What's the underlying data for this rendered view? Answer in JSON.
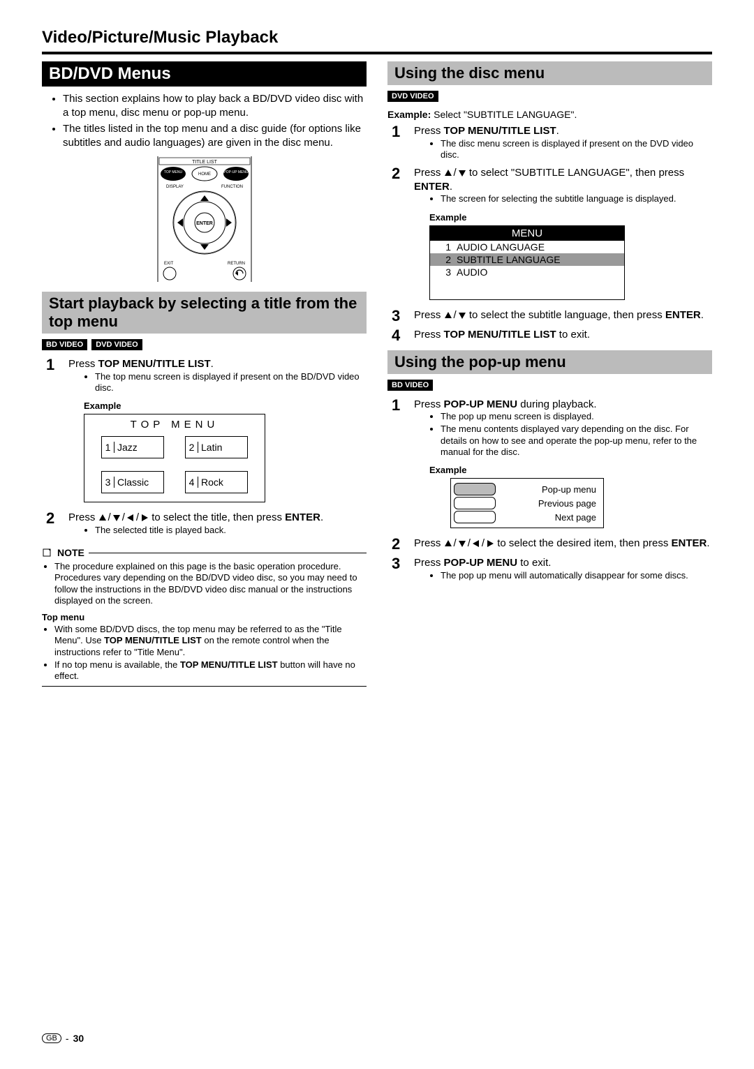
{
  "page": {
    "title": "Video/Picture/Music Playback"
  },
  "left": {
    "h_black": "BD/DVD Menus",
    "intro_bullets": [
      "This section explains how to play back a BD/DVD video disc with a top menu, disc menu or pop-up menu.",
      "The titles listed in the top menu and a disc guide (for options like subtitles and audio languages) are given in the disc menu."
    ],
    "remote": {
      "title_list": "TITLE LIST",
      "top_menu": "TOP MENU",
      "home": "HOME",
      "popup_menu": "POP-UP MENU",
      "display": "DISPLAY",
      "function": "FUNCTION",
      "enter": "ENTER",
      "exit": "EXIT",
      "return": "RETURN"
    },
    "h_gray": "Start playback by selecting a title from the top menu",
    "badges": [
      "BD VIDEO",
      "DVD VIDEO"
    ],
    "step1": {
      "text_pre": "Press ",
      "text_bold": "TOP MENU/TITLE LIST",
      "text_post": ".",
      "sub": "The top menu screen is displayed if present on the BD/DVD video disc."
    },
    "topmenu": {
      "example": "Example",
      "title": "TOP MENU",
      "cells": [
        {
          "n": "1",
          "t": "Jazz"
        },
        {
          "n": "2",
          "t": "Latin"
        },
        {
          "n": "3",
          "t": "Classic"
        },
        {
          "n": "4",
          "t": "Rock"
        }
      ]
    },
    "step2": {
      "text_pre": "Press ",
      "text_mid": " to select the title, then press ",
      "text_bold": "ENTER",
      "text_post": ".",
      "sub": "The selected title is played back."
    },
    "note": {
      "label": "NOTE",
      "bullets": [
        "The procedure explained on this page is the basic operation procedure. Procedures vary depending on the BD/DVD video disc, so you may need to follow the instructions in the BD/DVD video disc manual or the instructions displayed on the screen."
      ]
    },
    "topmenu_note": {
      "title": "Top menu",
      "b1_pre": "With some BD/DVD discs, the top menu may be referred to as the \"Title Menu\". Use ",
      "b1_bold": "TOP MENU/TITLE LIST",
      "b1_post": " on the remote control when the instructions refer to \"Title Menu\".",
      "b2_pre": "If no top menu is available, the ",
      "b2_bold": "TOP MENU/TITLE LIST",
      "b2_post": " button will have no effect."
    }
  },
  "right": {
    "h_gray1": "Using the disc menu",
    "badges1": [
      "DVD VIDEO"
    ],
    "example_line_pre": "Example:",
    "example_line_post": " Select \"SUBTITLE LANGUAGE\".",
    "r1_step1": {
      "text_pre": "Press ",
      "text_bold": "TOP MENU/TITLE LIST",
      "text_post": ".",
      "sub": "The disc menu screen is displayed if present on the DVD video disc."
    },
    "r1_step2": {
      "text_pre": "Press ",
      "text_mid": " to select \"SUBTITLE LANGUAGE\", then press ",
      "text_bold": "ENTER",
      "text_post": ".",
      "sub": "The screen for selecting the subtitle language is displayed."
    },
    "menu_ex": {
      "label": "Example",
      "header": "MENU",
      "rows": [
        {
          "n": "1",
          "t": "AUDIO LANGUAGE"
        },
        {
          "n": "2",
          "t": "SUBTITLE LANGUAGE"
        },
        {
          "n": "3",
          "t": "AUDIO"
        }
      ]
    },
    "r1_step3": {
      "text_pre": "Press ",
      "text_mid": " to select the subtitle language, then press ",
      "text_bold": "ENTER",
      "text_post": "."
    },
    "r1_step4": {
      "text_pre": "Press ",
      "text_bold": "TOP MENU/TITLE LIST",
      "text_post": " to exit."
    },
    "h_gray2": "Using the pop-up menu",
    "badges2": [
      "BD VIDEO"
    ],
    "r2_step1": {
      "text_pre": "Press ",
      "text_bold": "POP-UP MENU",
      "text_post": " during playback.",
      "subs": [
        "The pop up menu screen is displayed.",
        "The menu contents displayed vary depending on the disc. For details on how to see and operate the pop-up menu, refer to the manual for the disc."
      ]
    },
    "popup_ex": {
      "label": "Example",
      "rows": [
        "Pop-up menu",
        "Previous page",
        "Next page"
      ]
    },
    "r2_step2": {
      "text_pre": "Press ",
      "text_mid": " to select the desired item, then press ",
      "text_bold": "ENTER",
      "text_post": "."
    },
    "r2_step3": {
      "text_pre": "Press ",
      "text_bold": "POP-UP MENU",
      "text_post": " to exit.",
      "sub": "The pop up menu will automatically disappear for some discs."
    }
  },
  "footer": {
    "gb": "GB",
    "page": "30"
  }
}
